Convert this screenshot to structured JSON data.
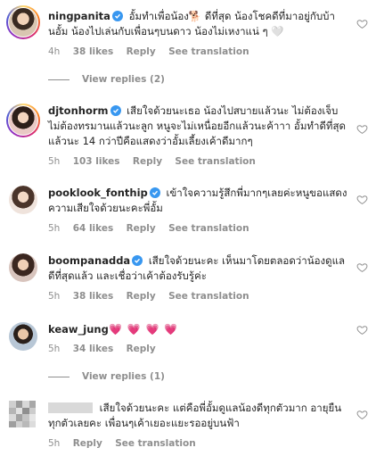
{
  "comments": [
    {
      "username": "ningpanita",
      "text": "อั้มทำเพื่อน้อง🐕 ดีที่สุด น้องโชคดีที่มาอยู่กับบ้านอั้ม น้องไปเล่นกับเพื่อนๆบนดาว น้องไม่เหงาแน่ ๆ 🤍",
      "time": "4h",
      "likes": "38 likes",
      "reply": "Reply",
      "translate": "See translation",
      "view_replies": "View replies (2)"
    },
    {
      "username": "djtonhorm",
      "text": "เสียใจด้วยนะเธอ น้องไปสบายแล้วนะ ไม่ต้องเจ็บไม่ต้องทรมานแล้วนะลูก หนูจะไม่เหนื่อยอีกแล้วนะค้าาา อั้มทำดีที่สุดแล้วนะ 14 กว่าปีคือแสดงว่าอั้มเลี้ยงเค้าดีมากๆ",
      "time": "5h",
      "likes": "103 likes",
      "reply": "Reply",
      "translate": "See translation"
    },
    {
      "username": "pooklook_fonthip",
      "text": "เข้าใจความรู้สึกพี่มากๆเลยค่ะหนูขอแสดงความเสียใจด้วยนะคะพี่อั้ม",
      "time": "5h",
      "likes": "64 likes",
      "reply": "Reply",
      "translate": "See translation"
    },
    {
      "username": "boompanadda",
      "text": "เสียใจด้วยนะคะ เห็นมาโดยตลอดว่าน้องดูแลดีที่สุดแล้ว และเชื่อว่าเค้าต้องรับรู้ค่ะ",
      "time": "5h",
      "likes": "38 likes",
      "reply": "Reply",
      "translate": "See translation"
    },
    {
      "username": "keaw_jung",
      "text": "💗 💗 💗 💗",
      "time": "5h",
      "likes": "34 likes",
      "reply": "Reply",
      "view_replies": "View replies (1)"
    },
    {
      "username": "",
      "text": "เสียใจด้วยนะคะ แต่คือพี่อั้มดูแลน้องดีทุกตัวมาก อายุยืนทุกตัวเลยคะ เพื่อนๆเค้าเยอะแยะรออยู่บนฟ้า",
      "time": "5h",
      "reply": "Reply",
      "translate": "See translation"
    }
  ],
  "colors": {
    "verified": "#3897f0",
    "meta": "#8e8e8e",
    "heart_outline": "#8e8e8e"
  }
}
